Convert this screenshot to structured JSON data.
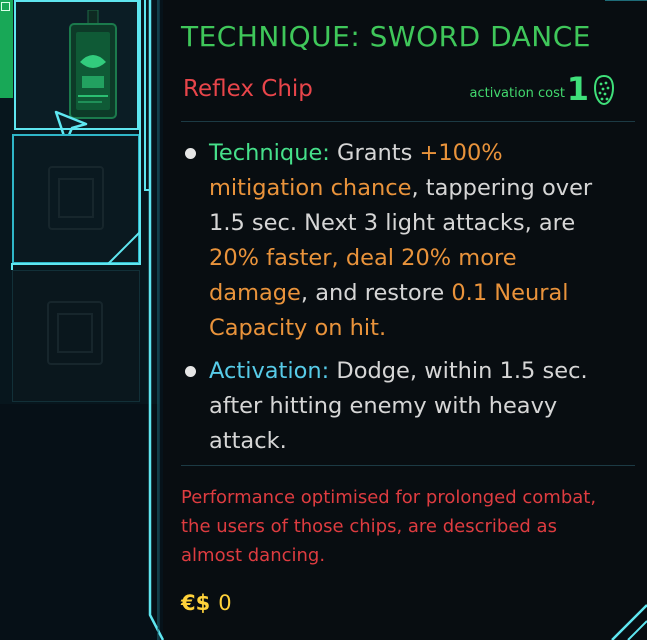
{
  "slots": {
    "items": [
      {
        "state": "equipped",
        "item": "reflex-chip"
      },
      {
        "state": "selected-empty"
      },
      {
        "state": "empty"
      }
    ]
  },
  "tooltip": {
    "title": "TECHNIQUE: SWORD DANCE",
    "type": "Reflex Chip",
    "activation_cost_label": "activation cost",
    "activation_cost_value": "1",
    "bullets": [
      {
        "label": "Technique:",
        "segments": [
          {
            "text": " Grants ",
            "hl": false
          },
          {
            "text": "+100% mitigation chance",
            "hl": true
          },
          {
            "text": ", tappering over 1.5 sec. Next 3 light attacks, are ",
            "hl": false
          },
          {
            "text": "20% faster, deal 20% more damage",
            "hl": true
          },
          {
            "text": ", and restore ",
            "hl": false
          },
          {
            "text": "0.1 Neural Capacity on hit.",
            "hl": true
          }
        ]
      },
      {
        "label": "Activation:",
        "segments": [
          {
            "text": " Dodge, within 1.5 sec. after hitting enemy with heavy attack.",
            "hl": false
          }
        ]
      }
    ],
    "flavor": "Performance optimised for prolonged combat, the users of those chips, are described as almost dancing.",
    "price_symbol": "€$",
    "price_value": "0"
  },
  "colors": {
    "frame": "#5fe6f0",
    "title": "#3fc75a",
    "type": "#e8454a",
    "highlight": "#e9933b",
    "flavor": "#de3c40",
    "price": "#ffd23a"
  }
}
